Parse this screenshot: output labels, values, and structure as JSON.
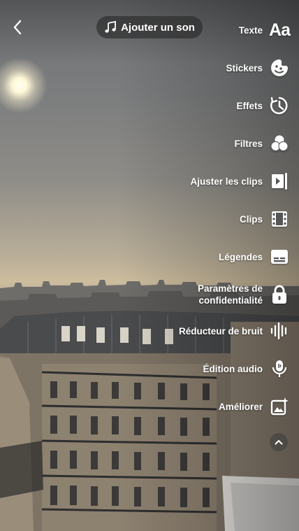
{
  "header": {
    "back_icon": "chevron-left-icon",
    "add_sound": {
      "icon": "music-note-icon",
      "label": "Ajouter un son"
    }
  },
  "tools": [
    {
      "id": "texte",
      "label": "Texte",
      "icon": "text-aa-icon"
    },
    {
      "id": "stickers",
      "label": "Stickers",
      "icon": "sticker-icon"
    },
    {
      "id": "effets",
      "label": "Effets",
      "icon": "effects-timer-icon"
    },
    {
      "id": "filtres",
      "label": "Filtres",
      "icon": "filters-circles-icon"
    },
    {
      "id": "ajuster",
      "label": "Ajuster les clips",
      "icon": "adjust-clips-icon"
    },
    {
      "id": "clips",
      "label": "Clips",
      "icon": "film-strip-icon"
    },
    {
      "id": "legendes",
      "label": "Légendes",
      "icon": "captions-icon"
    },
    {
      "id": "confidentialite",
      "label_line1": "Paramètres de",
      "label_line2": "confidentialité",
      "icon": "lock-icon"
    },
    {
      "id": "bruit",
      "label": "Réducteur de bruit",
      "icon": "noise-reducer-icon"
    },
    {
      "id": "audio",
      "label": "Édition audio",
      "icon": "audio-edit-icon"
    },
    {
      "id": "ameliorer",
      "label": "Améliorer",
      "icon": "enhance-sparkle-icon"
    }
  ],
  "collapse_icon": "chevron-up-icon"
}
